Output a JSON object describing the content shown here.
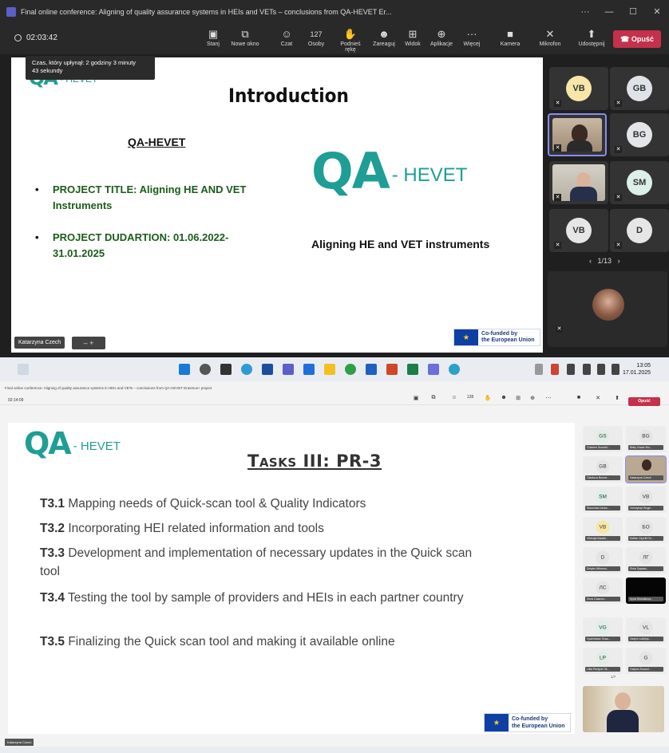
{
  "screen1": {
    "window_title": "Final online conference: Aligning of quality assurance systems in HEIs and VETs – conclusions from QA-HEVET Er...",
    "window_controls": {
      "more": "···",
      "minimize": "—",
      "maximize": "☐",
      "close": "✕"
    },
    "timer": "02:03:42",
    "tooltip_line1": "Czas, który upłynął: 2 godziny 3 minuty",
    "tooltip_line2": "43 sekundy",
    "toolbar": [
      {
        "label": "Stanj",
        "icon": "▣"
      },
      {
        "label": "Nowe okno",
        "icon": "⧉"
      },
      {
        "label": "Czat",
        "icon": "☺"
      },
      {
        "label": "Osoby",
        "icon": "127"
      },
      {
        "label": "Podnieś rękę",
        "icon": "✋"
      },
      {
        "label": "Zareaguj",
        "icon": "☻"
      },
      {
        "label": "Widok",
        "icon": "⊞"
      },
      {
        "label": "Aplikacje",
        "icon": "⊕"
      },
      {
        "label": "Więcej",
        "icon": "···"
      },
      {
        "label": "Kamera",
        "icon": "■"
      },
      {
        "label": "Mikrofon",
        "icon": "✕"
      },
      {
        "label": "Udostępnij",
        "icon": "⬆"
      }
    ],
    "leave_label": "Opuść",
    "leave_icon": "☎",
    "slide": {
      "logo_qa": "QA",
      "logo_hevet": "- HEVET",
      "title": "Introduction",
      "subtitle": "QA-HEVET",
      "bullet1_line1": "PROJECT TITLE: Aligning HE AND VET",
      "bullet1_line2": "Instruments",
      "bullet2_line1": "PROJECT DUDARTION: 01.06.2022-",
      "bullet2_line2": "31.01.2025",
      "tagline": "Aligning HE and VET instruments",
      "eu_line1": "Co-funded by",
      "eu_line2": "the European Union"
    },
    "presenter_name": "Katarzyna Czech",
    "zoom_controls": "–   +",
    "participants": [
      {
        "initials": "VB"
      },
      {
        "initials": "GB"
      },
      {
        "initials": ""
      },
      {
        "initials": "BG"
      },
      {
        "initials": ""
      },
      {
        "initials": "SM"
      },
      {
        "initials": "VB"
      },
      {
        "initials": "D"
      }
    ],
    "pager": "1/13",
    "pager_prev": "‹",
    "pager_next": "›",
    "mute_icon": "✕",
    "clock_time": "13:05",
    "clock_date": "17.01.2025"
  },
  "screen2": {
    "window_title": "Final online conference: Aligning of quality assurance systems in HEIs and VETs – conclusions from QA-HEVET Erasmus+ project",
    "timer": "02:14:09",
    "people_count": "128",
    "leave_label": "Opuść",
    "slide": {
      "logo_qa": "QA",
      "logo_hevet": "- HEVET",
      "title": "Tasks III: PR-3",
      "tasks": [
        {
          "code": "T3.1",
          "text": "Mapping needs of Quick-scan tool & Quality Indicators"
        },
        {
          "code": "T3.2",
          "text": "Incorporating HEI related information and tools"
        },
        {
          "code": "T3.3",
          "text": "Development and implementation of necessary updates in the Quick scan tool"
        },
        {
          "code": "T3.4",
          "text": "Testing the tool by sample of providers and HEIs in each partner country"
        },
        {
          "code": "T3.5",
          "text": "Finalizing the Quick scan tool and making it available online"
        }
      ],
      "eu_line1": "Co-funded by",
      "eu_line2": "the European Union"
    },
    "participants": [
      {
        "initials": "GS",
        "name": "Gulshen Suveidi..."
      },
      {
        "initials": "BG",
        "name": "Betty Grace Wu..."
      },
      {
        "initials": "GB",
        "name": "Gianluca Brunet..."
      },
      {
        "initials": "",
        "name": "Katarzyna Czech"
      },
      {
        "initials": "SM",
        "name": "Slavomad Javko..."
      },
      {
        "initials": "VB",
        "name": "Volodymyr Bogd..."
      },
      {
        "initials": "VB",
        "name": "Viktorija Badzik..."
      },
      {
        "initials": "БО",
        "name": "Бабан Сергій Ол..."
      },
      {
        "initials": "D",
        "name": "Dmytro Mironov..."
      },
      {
        "initials": "ЛГ",
        "name": "Лілія Грушка..."
      },
      {
        "initials": "ЛС",
        "name": "Лена Самсон..."
      },
      {
        "initials": "",
        "name": "Iryna Shumikova..."
      },
      {
        "initials": "VG",
        "name": "Vyacheslav Gosu..."
      },
      {
        "initials": "VL",
        "name": "Vadym Lokhtyk..."
      },
      {
        "initials": "LP",
        "name": "Liliia Pavlyuk Ok..."
      },
      {
        "initials": "G",
        "name": "Galyna Zhuravl..."
      }
    ],
    "pager": "1/7",
    "presenter_name": "Katarzyna Czech"
  }
}
